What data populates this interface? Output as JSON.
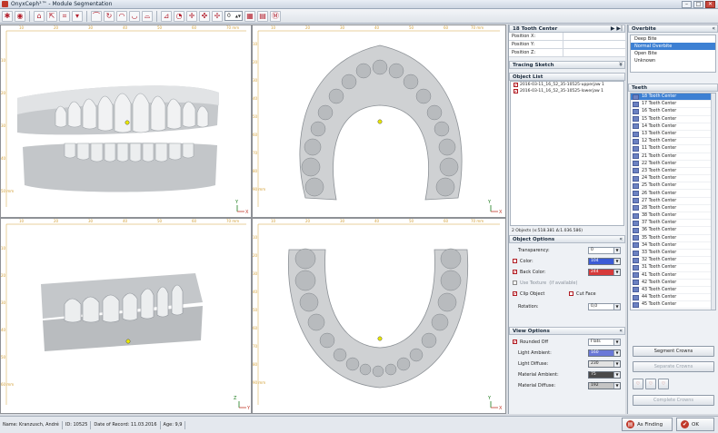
{
  "window": {
    "title": "OnyxCeph³™ - Module Segmentation"
  },
  "toolbar": {
    "spin_value": "0"
  },
  "rulers": {
    "top_ticks": [
      "10",
      "20",
      "30",
      "40",
      "50",
      "60",
      "70 mm"
    ],
    "left_ticks_top": [
      "10",
      "20",
      "30",
      "40",
      "50 mm"
    ],
    "left_ticks_right_top": [
      "10",
      "20",
      "30",
      "40",
      "50",
      "60",
      "70",
      "80",
      "90 mm"
    ],
    "left_ticks_bottom": [
      "10",
      "20",
      "30",
      "40",
      "50",
      "60 mm"
    ],
    "left_ticks_right_bottom": [
      "10",
      "20",
      "30",
      "40",
      "50",
      "60",
      "70",
      "80",
      "90 mm"
    ]
  },
  "tooth_center": {
    "title": "18 Tooth Center",
    "fields": [
      {
        "label": "Position X:",
        "value": ""
      },
      {
        "label": "Position Y:",
        "value": ""
      },
      {
        "label": "Position Z:",
        "value": ""
      }
    ]
  },
  "tracing_sketch": {
    "title": "Tracing Sketch"
  },
  "object_list": {
    "title": "Object List",
    "items": [
      "2016-03-11_16_52_35-10525-upperjaw 1",
      "2016-03-11_16_52_35-10525-lowerjaw 1"
    ],
    "summary": "2 Objects (x:518.381 Δ:1.036.586)"
  },
  "object_options": {
    "title": "Object Options",
    "transparency_label": "Transparency:",
    "transparency_value": "0",
    "color_label": "Color:",
    "color_value": "104",
    "back_color_label": "Back Color:",
    "back_color_value": "244",
    "use_texture_label": "Use Texture",
    "if_available": "(if available)",
    "clip_object_label": "Clip Object",
    "cut_face_label": "Cut Face",
    "rotation_label": "Rotation:",
    "rotation_value": "0,0",
    "color_hex": "#3b5bd6",
    "back_color_hex": "#d63a3a"
  },
  "view_options": {
    "title": "View Options",
    "rounded_off_label": "Rounded Off",
    "rounded_off_value": "Flats",
    "light_ambient_label": "Light Ambient:",
    "light_ambient_value": "160",
    "light_diffuse_label": "Light Diffuse:",
    "light_diffuse_value": "230",
    "material_ambient_label": "Material Ambient:",
    "material_ambient_value": "75",
    "material_diffuse_label": "Material Diffuse:",
    "material_diffuse_value": "192"
  },
  "overbite": {
    "title": "Overbite",
    "options": [
      "Deep Bite",
      "Normal Overbite",
      "Open Bite",
      "Unknown"
    ],
    "selected": "Normal Overbite"
  },
  "teeth": {
    "title": "Teeth",
    "items": [
      "18 Tooth Center",
      "17 Tooth Center",
      "16 Tooth Center",
      "15 Tooth Center",
      "14 Tooth Center",
      "13 Tooth Center",
      "12 Tooth Center",
      "11 Tooth Center",
      "21 Tooth Center",
      "22 Tooth Center",
      "23 Tooth Center",
      "24 Tooth Center",
      "25 Tooth Center",
      "26 Tooth Center",
      "27 Tooth Center",
      "28 Tooth Center",
      "38 Tooth Center",
      "37 Tooth Center",
      "36 Tooth Center",
      "35 Tooth Center",
      "34 Tooth Center",
      "33 Tooth Center",
      "32 Tooth Center",
      "31 Tooth Center",
      "41 Tooth Center",
      "42 Tooth Center",
      "43 Tooth Center",
      "44 Tooth Center",
      "45 Tooth Center"
    ]
  },
  "actions": {
    "segment_crowns": "Segment Crowns",
    "separate_crowns": "Separate Crowns",
    "complete_crowns": "Complete Crowns"
  },
  "status": {
    "name": "Name: Kranzusch, André",
    "id": "ID: 10525",
    "record_date": "Date of Record: 11.03.2016",
    "age": "Age: 9,9"
  },
  "footer": {
    "as_finding": "As Finding",
    "ok": "OK"
  }
}
